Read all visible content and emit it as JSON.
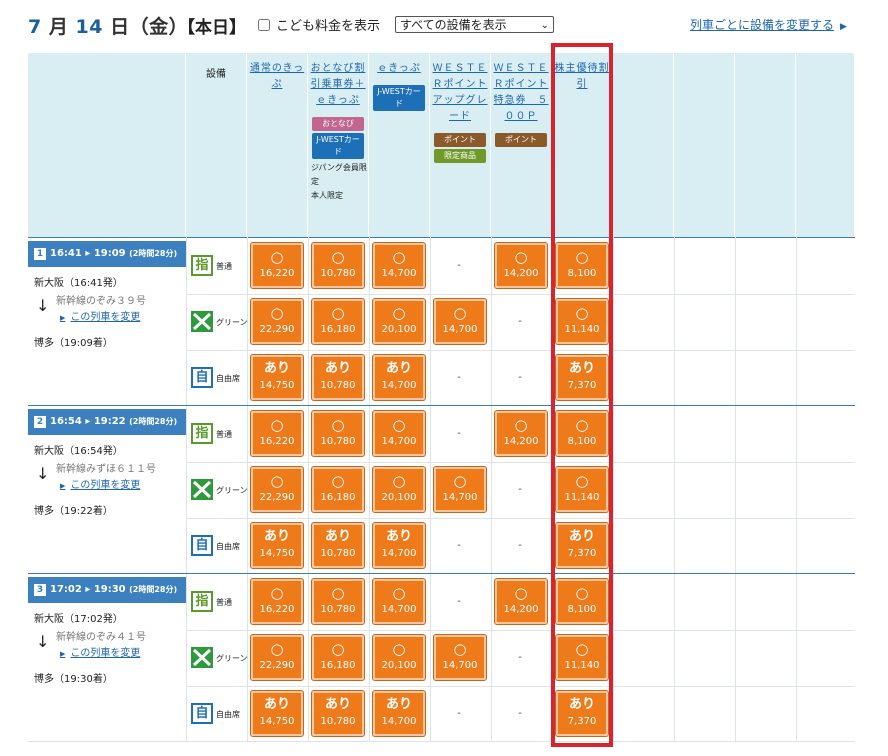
{
  "header": {
    "date_month": "7",
    "date_month_unit": "月",
    "date_day": "14",
    "date_day_unit": "日",
    "date_weekday": "（金）",
    "today_label": "【本日】",
    "child_fare_label": "こども料金を表示",
    "child_fare_checked": false,
    "facility_select_value": "すべての設備を表示",
    "change_facility_link": "列車ごとに設備を変更する"
  },
  "columns": {
    "facility_header": "設備",
    "fares": [
      {
        "title": "通常のきっぷ",
        "badges": [],
        "notes": []
      },
      {
        "title": "おとなび割引乗車券＋ｅきっぷ",
        "badges": [
          {
            "text": "おとなび",
            "color": "#c2658f"
          },
          {
            "text": "J-WESTカード",
            "color": "#1d6fb8"
          }
        ],
        "notes": [
          "ジパング会員限定",
          "本人限定"
        ]
      },
      {
        "title": "ｅきっぷ",
        "badges": [
          {
            "text": "J-WESTカード",
            "color": "#1d6fb8"
          }
        ],
        "notes": []
      },
      {
        "title": "ＷＥＳＴＥＲポイントアップグレード",
        "badges": [
          {
            "text": "ポイント",
            "color": "#8b5a2b"
          },
          {
            "text": "限定商品",
            "color": "#6f9a2a"
          }
        ],
        "notes": []
      },
      {
        "title": "ＷＥＳＴＥＲポイント特急券　５００Ｐ",
        "badges": [
          {
            "text": "ポイント",
            "color": "#8b5a2b"
          }
        ],
        "notes": []
      },
      {
        "title": "株主優待割引",
        "badges": [],
        "notes": []
      }
    ]
  },
  "seat_types": [
    {
      "icon": "reserved-seat-icon",
      "glyph": "指",
      "label": "普通",
      "color": "#5a9a2a"
    },
    {
      "icon": "green-car-icon",
      "glyph": "",
      "label": "グリーン",
      "color": "#2e9a3c"
    },
    {
      "icon": "non-reserved-seat-icon",
      "glyph": "自",
      "label": "自由席",
      "color": "#1d6fb8"
    }
  ],
  "trains": [
    {
      "number": "1",
      "time": "16:41 ▸ 19:09",
      "duration": "(2時間28分)",
      "departure": "新大阪（16:41発）",
      "via": "新幹線のぞみ３９号",
      "change_link": "この列車を変更",
      "arrival": "博多（19:09着）",
      "rows": [
        [
          "○",
          "16,220",
          "○",
          "10,780",
          "○",
          "14,700",
          "-",
          "",
          "○",
          "14,200",
          "○",
          "8,100"
        ],
        [
          "○",
          "22,290",
          "○",
          "16,180",
          "○",
          "20,100",
          "○",
          "14,700",
          "-",
          "",
          "○",
          "11,140"
        ],
        [
          "あり",
          "14,750",
          "あり",
          "10,780",
          "あり",
          "14,700",
          "-",
          "",
          "-",
          "",
          "あり",
          "7,370"
        ]
      ]
    },
    {
      "number": "2",
      "time": "16:54 ▸ 19:22",
      "duration": "(2時間28分)",
      "departure": "新大阪（16:54発）",
      "via": "新幹線みずほ６１１号",
      "change_link": "この列車を変更",
      "arrival": "博多（19:22着）",
      "rows": [
        [
          "○",
          "16,220",
          "○",
          "10,780",
          "○",
          "14,700",
          "-",
          "",
          "○",
          "14,200",
          "○",
          "8,100"
        ],
        [
          "○",
          "22,290",
          "○",
          "16,180",
          "○",
          "20,100",
          "○",
          "14,700",
          "-",
          "",
          "○",
          "11,140"
        ],
        [
          "あり",
          "14,750",
          "あり",
          "10,780",
          "あり",
          "14,700",
          "-",
          "",
          "-",
          "",
          "あり",
          "7,370"
        ]
      ]
    },
    {
      "number": "3",
      "time": "17:02 ▸ 19:30",
      "duration": "(2時間28分)",
      "departure": "新大阪（17:02発）",
      "via": "新幹線のぞみ４１号",
      "change_link": "この列車を変更",
      "arrival": "博多（19:30着）",
      "rows": [
        [
          "○",
          "16,220",
          "○",
          "10,780",
          "○",
          "14,700",
          "-",
          "",
          "○",
          "14,200",
          "○",
          "8,100"
        ],
        [
          "○",
          "22,290",
          "○",
          "16,180",
          "○",
          "20,100",
          "○",
          "14,700",
          "-",
          "",
          "○",
          "11,140"
        ],
        [
          "あり",
          "14,750",
          "あり",
          "10,780",
          "あり",
          "14,700",
          "-",
          "",
          "-",
          "",
          "あり",
          "7,370"
        ]
      ]
    }
  ],
  "highlight_color": "#d9232d"
}
